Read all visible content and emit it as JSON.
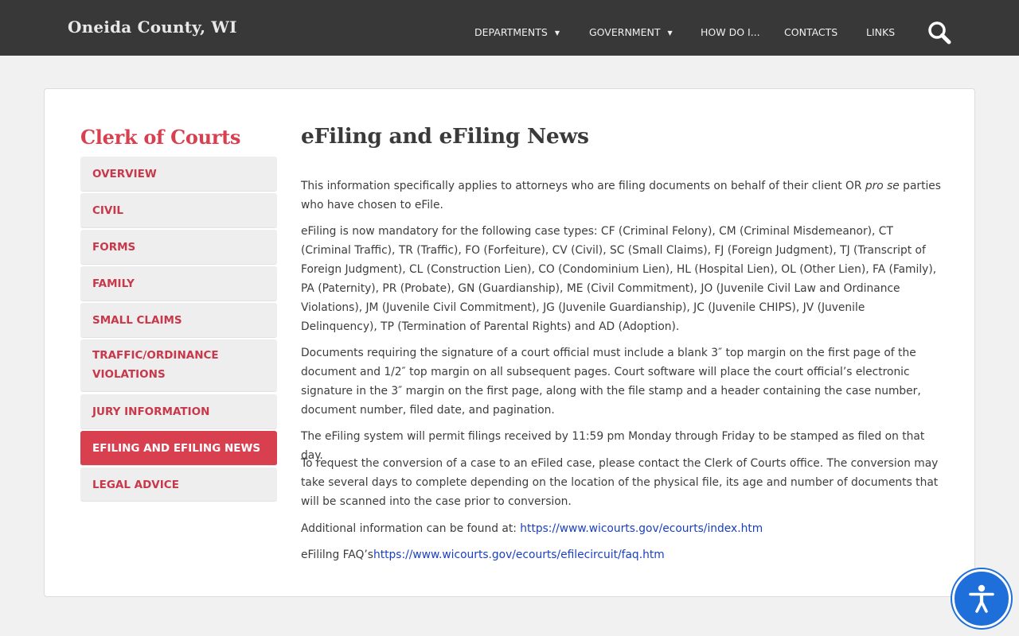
{
  "header": {
    "site_title": "Oneida County, WI",
    "nav": [
      {
        "label": "DEPARTMENTS",
        "caret": "▼"
      },
      {
        "label": "GOVERNMENT",
        "caret": "▼"
      },
      {
        "label": "HOW DO I..."
      },
      {
        "label": "CONTACTS"
      },
      {
        "label": "LINKS"
      }
    ],
    "search_icon": "search-icon"
  },
  "sidebar": {
    "title": "Clerk of Courts",
    "items": [
      {
        "label": "OVERVIEW"
      },
      {
        "label": "CIVIL"
      },
      {
        "label": "FORMS"
      },
      {
        "label": "FAMILY"
      },
      {
        "label": "SMALL CLAIMS"
      },
      {
        "label_line1": "TRAFFIC/ORDINANCE",
        "label_line2": "VIOLATIONS"
      },
      {
        "label": "JURY INFORMATION"
      },
      {
        "label": "EFILING AND EFILING NEWS",
        "active": true
      },
      {
        "label": "LEGAL ADVICE"
      }
    ]
  },
  "main": {
    "title": "eFiling and eFiling News",
    "p1_before": "This information specifically applies to attorneys who are filing documents on behalf of their client OR ",
    "p1_em": "pro se",
    "p1_after": " parties who have chosen to eFile.",
    "p2": "eFiling is now mandatory for the following case types: CF (Criminal Felony), CM (Criminal Misdemeanor), CT (Criminal Traffic), TR (Traffic), FO (Forfeiture), CV (Civil), SC (Small Claims), FJ (Foreign Judgment), TJ (Transcript of Foreign Judgment), CL (Construction Lien), CO (Condominium Lien), HL (Hospital Lien), OL (Other Lien), FA (Family), PA (Paternity), PR (Probate), GN (Guardianship), ME (Civil Commitment), JO (Juvenile Civil Law and Ordinance Violations), JM (Juvenile Civil Commitment), JG (Juvenile Guardianship), JC (Juvenile CHIPS), JV (Juvenile Delinquency), TP (Termination of Parental Rights) and AD (Adoption).",
    "p3": "Documents requiring the signature of a court official must include a blank 3″ top margin on the first page of the document and 1/2″ top margin on all subsequent pages. Court software will place the court official’s electronic signature in the 3″ margin on the first page, along with the file stamp and a header containing the case number, document number, filed date, and pagination.",
    "p4": "The eFiling system will permit filings received by 11:59 pm Monday through Friday to be stamped as filed on that day.",
    "p5": "To request the conversion of a case to an eFiled case, please contact the Clerk of Courts office. The conversion may take several days to complete depending on the location of the physical file, its age and number of documents that will be scanned into the case prior to conversion.",
    "p6_prefix": "Additional information can be found at: ",
    "p6_link": "https://www.wicourts.gov/ecourts/index.htm",
    "p7_prefix": "eFililng FAQ’s",
    "p7_link": "https://www.wicourts.gov/ecourts/efilecircuit/faq.htm"
  },
  "accessibility_button": {
    "icon": "accessibility-icon"
  },
  "colors": {
    "header_bg": "#383838",
    "accent": "#d9404f",
    "link": "#1a3fbf",
    "a11y": "#1e6fd9"
  }
}
